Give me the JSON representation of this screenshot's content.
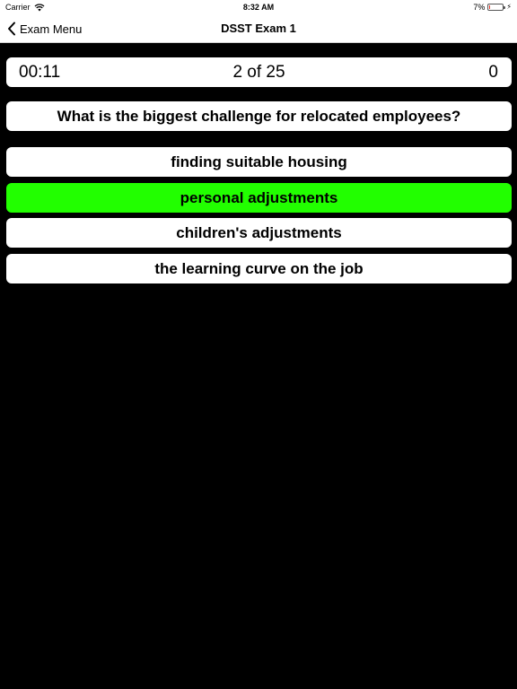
{
  "status_bar": {
    "carrier": "Carrier",
    "time": "8:32 AM",
    "battery_percent": "7%",
    "battery_level": 0.07,
    "battery_color": "#e53b30"
  },
  "nav": {
    "back_label": "Exam Menu",
    "title": "DSST Exam 1"
  },
  "info": {
    "timer": "00:11",
    "progress": "2 of 25",
    "score": "0"
  },
  "question": {
    "text": "What is the biggest challenge for relocated employees?"
  },
  "answers": [
    {
      "label": "finding suitable housing",
      "selected": false
    },
    {
      "label": "personal adjustments",
      "selected": true
    },
    {
      "label": "children's adjustments",
      "selected": false
    },
    {
      "label": "the learning curve on the job",
      "selected": false
    }
  ],
  "colors": {
    "background": "#000000",
    "card": "#ffffff",
    "selected_answer": "#22ff00"
  },
  "icons": {
    "wifi": "wifi-icon",
    "battery": "battery-icon",
    "charging": "bolt-icon",
    "back": "chevron-left-icon"
  }
}
